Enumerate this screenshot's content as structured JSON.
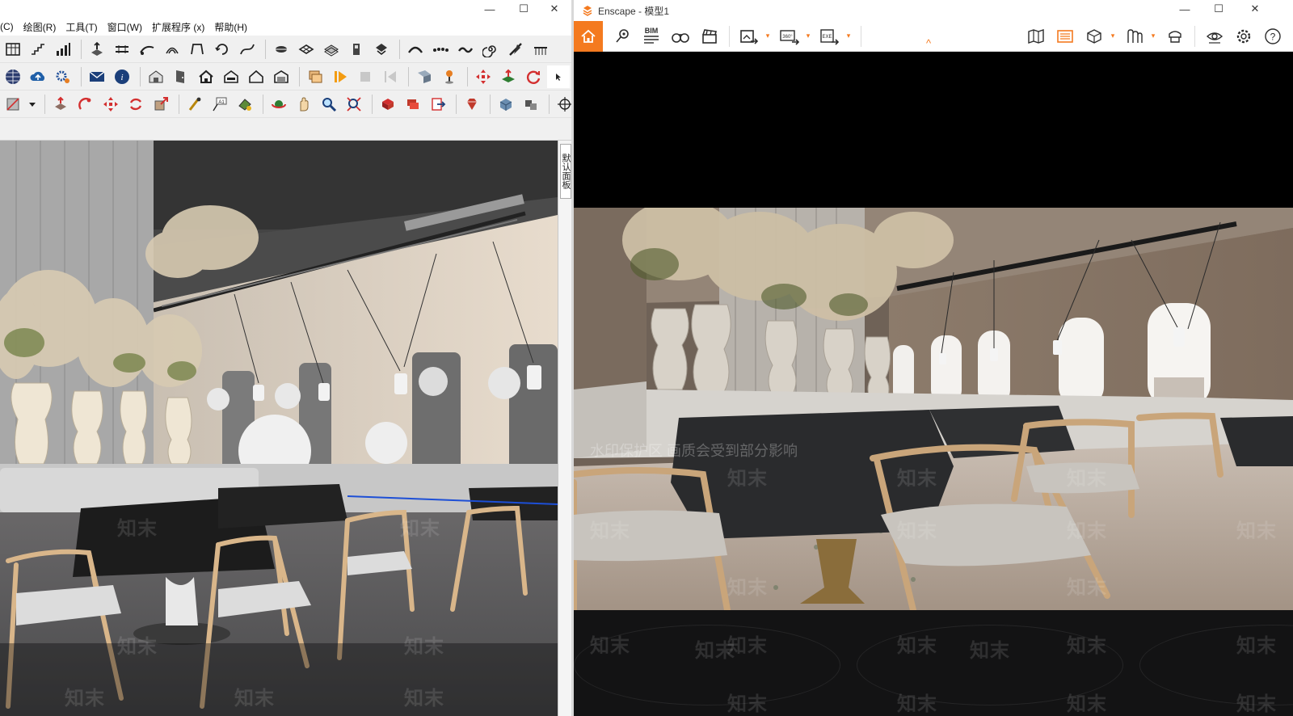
{
  "left_window": {
    "menu": [
      "(C)",
      "绘图(R)",
      "工具(T)",
      "窗口(W)",
      "扩展程序 (x)",
      "帮助(H)"
    ],
    "window_controls": {
      "minimize": "—",
      "maximize": "☐",
      "close": "✕"
    },
    "side_panel_label": "默认面板",
    "toolbar_row1": [
      "table-icon",
      "stairs-icon",
      "bar-chart-icon",
      "push-pull-icon",
      "rail-icon",
      "follow-path-icon",
      "offset-icon",
      "arc-icon",
      "rotate-icon",
      "bend-icon",
      "circle-tool-icon",
      "grid-plane-icon",
      "scatter-icon",
      "extrude-icon",
      "loft-icon",
      "curve-icon",
      "dots-icon",
      "wave-icon",
      "spiral-icon",
      "knife-icon",
      "comb-icon"
    ],
    "toolbar_row2": [
      "sphere-icon",
      "cloud-upload-icon",
      "settings-icon",
      "mail-icon",
      "info-icon",
      "warehouse-icon",
      "door-icon",
      "house-icon",
      "shop-icon",
      "house-outline-icon",
      "garage-icon",
      "animation-icon",
      "play-icon",
      "stop-icon",
      "rewind-icon",
      "scene-icon",
      "pin-icon",
      "move-icon",
      "layer-move-icon",
      "refresh-icon",
      "pointer-icon"
    ],
    "toolbar_row3": [
      "section-icon",
      "dropdown-icon",
      "push-icon",
      "laser-icon",
      "move-arrows-icon",
      "rotate-arrows-icon",
      "scale-icon",
      "tape-icon",
      "text-icon",
      "paint-icon",
      "orbit-icon",
      "pan-icon",
      "zoom-icon",
      "zoom-extents-icon",
      "component-icon",
      "stack-icon",
      "export-icon",
      "ruby-icon",
      "cube-icon",
      "cubes-icon",
      "crosshair-icon"
    ]
  },
  "right_window": {
    "title": "Enscape - 模型1",
    "window_controls": {
      "minimize": "—",
      "maximize": "☐",
      "close": "✕"
    },
    "toolbar": {
      "bim_label": "BIM",
      "tools_left": [
        "home-icon",
        "location-icon",
        "bim-list-icon",
        "binoculars-icon",
        "clapperboard-icon",
        "screenshot-export-icon",
        "panorama-360-icon",
        "exe-export-icon"
      ],
      "tools_right": [
        "map-icon",
        "render-frame-icon",
        "cube-view-icon",
        "materials-icon",
        "asset-icon",
        "eye-icon",
        "settings-gear-icon",
        "help-icon"
      ],
      "export_360_label": "360°",
      "export_exe_label": "EXE"
    },
    "collapse_glyph": "^"
  },
  "watermarks": {
    "brand": "知末",
    "banner": "水印保护区  画质会受到部分影响"
  }
}
